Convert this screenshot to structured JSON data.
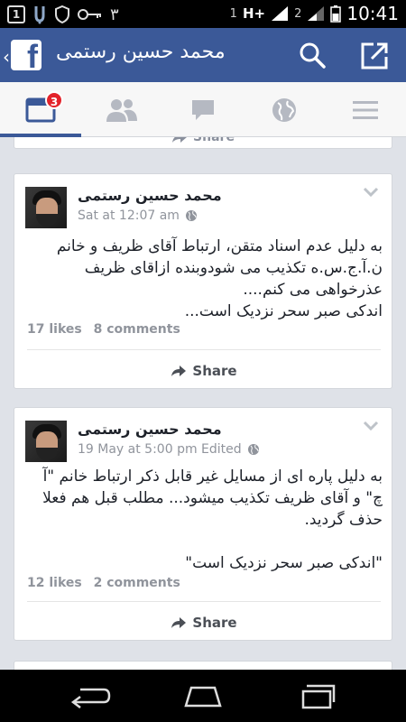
{
  "status_bar": {
    "notif_box": "1",
    "notif_num": "٣",
    "sim_label": "1",
    "network": "H+",
    "sim2_label": "2",
    "time": "10:41"
  },
  "header": {
    "logo_letter": "f",
    "title": "محمد حسین رستمی"
  },
  "tabs": {
    "news_feed_badge": "3",
    "active": "news-feed"
  },
  "top_card": {
    "share_label": "Share"
  },
  "posts": [
    {
      "author": "محمد حسین رستمی",
      "meta": "Sat at 12:07 am",
      "text_lines": [
        "به دلیل عدم اسناد متقن، ارتباط آقای ظریف و خانم",
        "ن.آ.ج.س.ه تکذیب می شودوبنده ازاقای ظریف",
        "عذرخواهی می کنم....",
        "اندکی صبر سحر نزدیک است..."
      ],
      "likes": "17 likes",
      "comments": "8 comments",
      "share_label": "Share"
    },
    {
      "author": "محمد حسین رستمی",
      "meta": "19 May at 5:00 pm Edited",
      "text_lines": [
        "به دلیل پاره ای از مسایل غیر قابل ذکر ارتباط خانم \"آ",
        "چ\" و آقای ظریف تکذیب میشود... مطلب قبل هم فعلا",
        "حذف گردید.",
        "",
        "\"اندکی صبر سحر نزدیک است\""
      ],
      "likes": "12 likes",
      "comments": "2 comments",
      "share_label": "Share"
    }
  ],
  "colors": {
    "brand": "#3b5998",
    "badge": "#e3232b",
    "feed_bg": "#dfe2e8"
  },
  "icons": [
    "facebook-logo-icon",
    "search-icon",
    "share-out-icon",
    "news-feed-icon",
    "friends-icon",
    "messages-icon",
    "globe-icon",
    "menu-icon",
    "chevron-down-icon",
    "share-arrow-icon",
    "back-icon",
    "home-icon",
    "recent-apps-icon"
  ]
}
